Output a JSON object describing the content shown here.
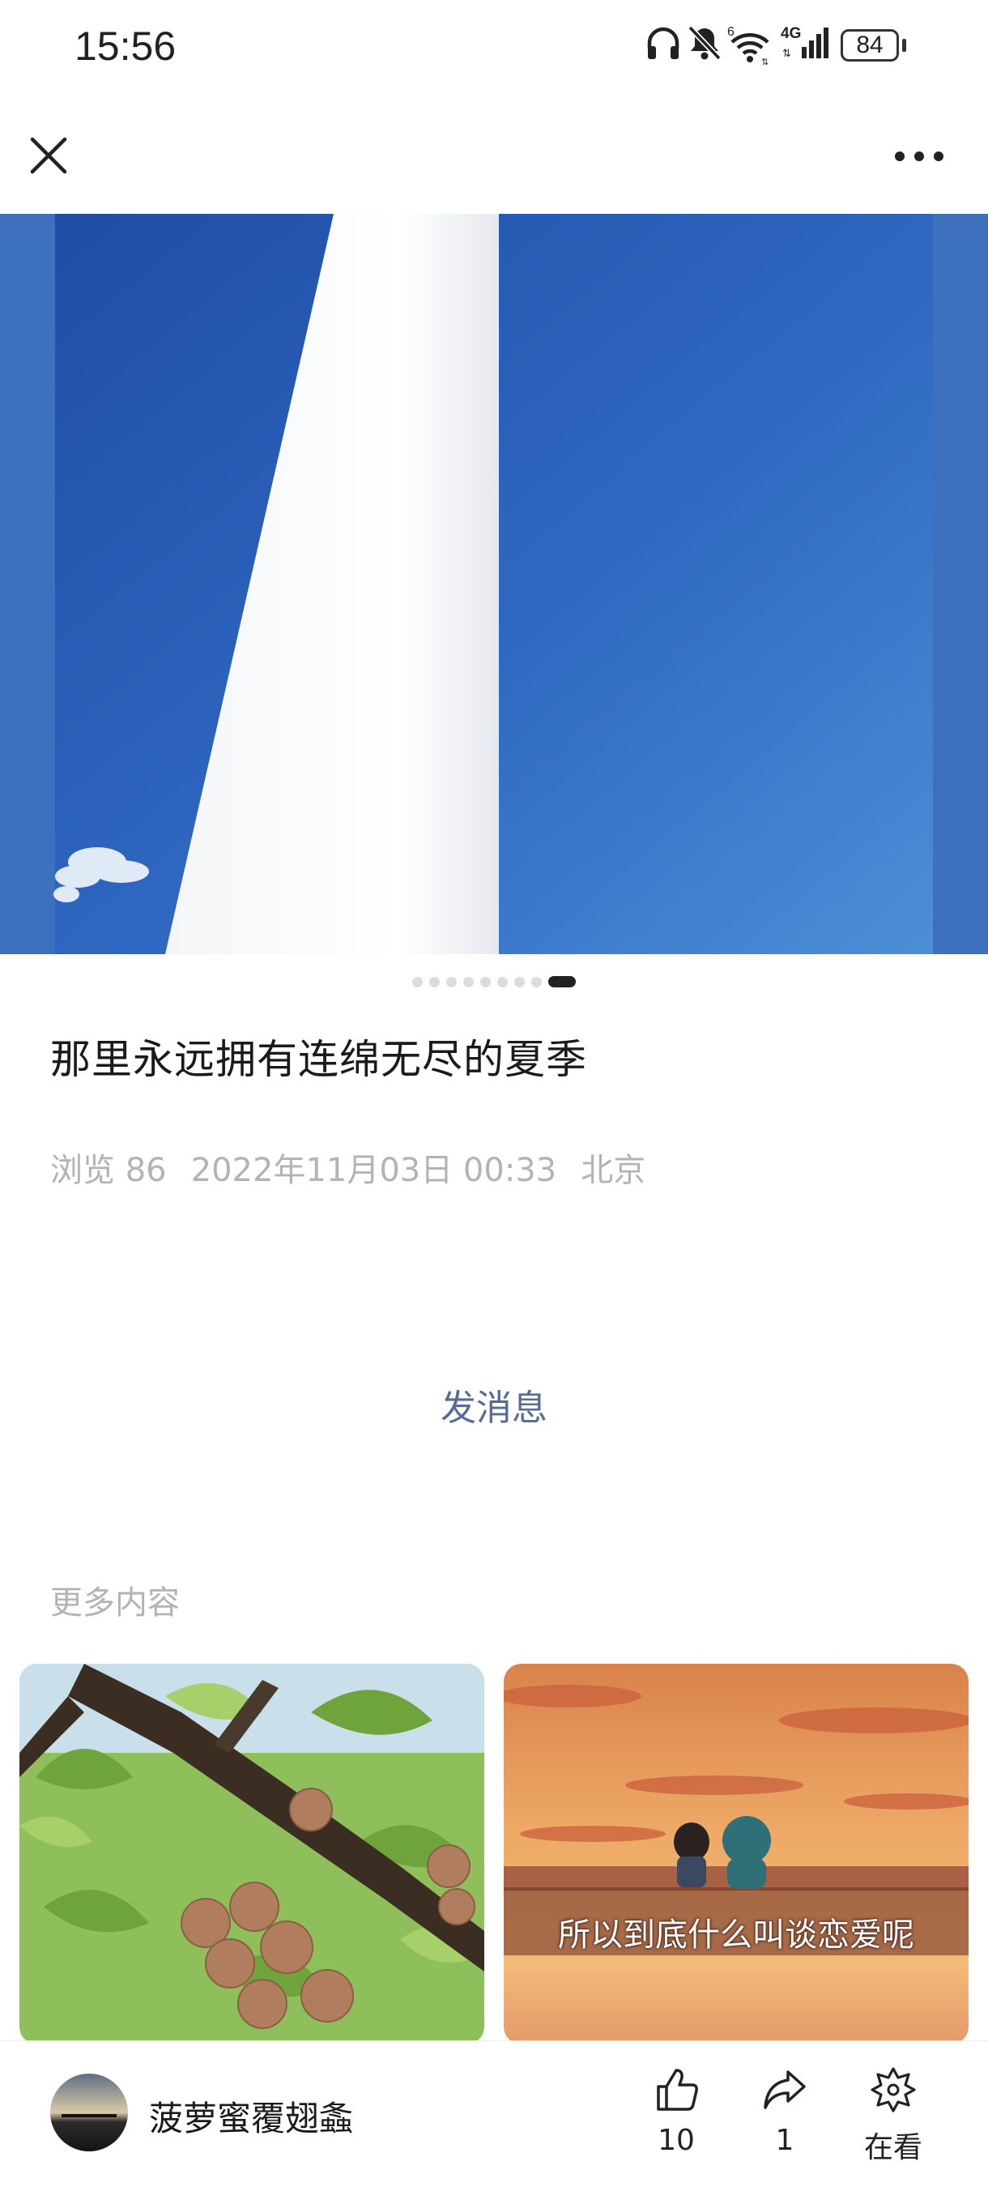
{
  "status_bar": {
    "time": "15:56",
    "network": "4G",
    "wifi_badge": "6",
    "battery": "84",
    "icons": [
      "headphones-icon",
      "mute-bell-icon",
      "wifi-icon",
      "cellular-signal-icon",
      "battery-icon"
    ]
  },
  "top_bar": {
    "close_icon": "close-icon",
    "more_icon": "more-horizontal-icon"
  },
  "gallery": {
    "page_count": 9,
    "current_page": 9
  },
  "post": {
    "title": "那里永远拥有连绵无尽的夏季",
    "views": "浏览 86",
    "date": "2022年11月03日 00:33",
    "location": "北京"
  },
  "send_message_label": "发消息",
  "more_content_label": "更多内容",
  "cards": [
    {
      "caption": ""
    },
    {
      "caption": "所以到底什么叫谈恋爱呢"
    }
  ],
  "bottom_bar": {
    "author": "菠萝蜜覆翅螽",
    "like_count": "10",
    "share_count": "1",
    "wow_label": "在看"
  },
  "colors": {
    "link": "#576b95",
    "sky": "#2f62b8",
    "muted_text": "#b3b3b3"
  }
}
